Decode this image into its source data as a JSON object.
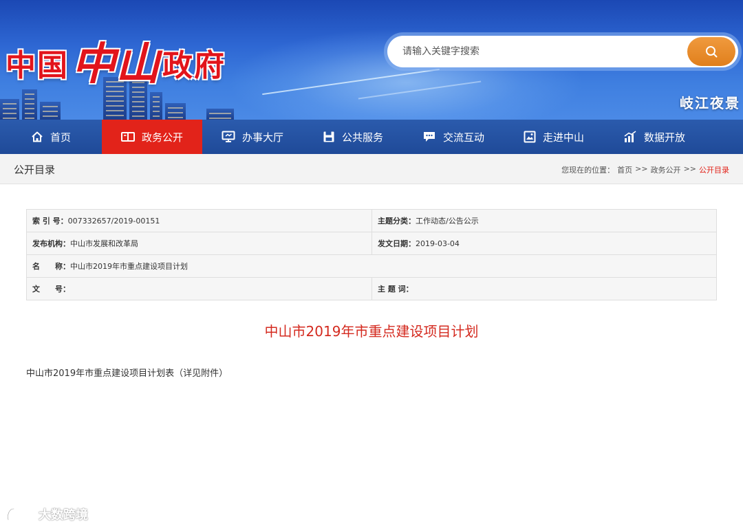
{
  "header": {
    "logo_prefix": "中国",
    "logo_main": "中山",
    "logo_suffix": "政府",
    "search_placeholder": "请输入关键字搜索",
    "motto": "岐江夜景"
  },
  "nav": {
    "items": [
      {
        "label": "首页",
        "icon": "home-icon"
      },
      {
        "label": "政务公开",
        "icon": "book-icon"
      },
      {
        "label": "办事大厅",
        "icon": "monitor-icon"
      },
      {
        "label": "公共服务",
        "icon": "save-icon"
      },
      {
        "label": "交流互动",
        "icon": "chat-icon"
      },
      {
        "label": "走进中山",
        "icon": "picture-icon"
      },
      {
        "label": "数据开放",
        "icon": "chart-icon"
      }
    ],
    "active_index": 1,
    "active_color": "#e2231a"
  },
  "breadcrumb": {
    "section_title": "公开目录",
    "prefix": "您现在的位置：",
    "items": [
      "首页",
      "政务公开",
      "公开目录"
    ],
    "separator": ">>"
  },
  "info": {
    "index_label": "索 引 号：",
    "index_value": "007332657/2019-00151",
    "topic_label": "主题分类：",
    "topic_value": "工作动态/公告公示",
    "org_label": "发布机构：",
    "org_value": "中山市发展和改革局",
    "date_label": "发文日期：",
    "date_value": "2019-03-04",
    "name_label": "名　　称：",
    "name_value": "中山市2019年市重点建设项目计划",
    "docno_label": "文　　号：",
    "docno_value": "",
    "keyword_label": "主 题 词：",
    "keyword_value": ""
  },
  "document": {
    "title": "中山市2019年市重点建设项目计划",
    "body": "中山市2019年市重点建设项目计划表（详见附件）"
  },
  "watermark": {
    "text": "大数跨境"
  },
  "colors": {
    "nav_bg": "#2556a6",
    "accent_red": "#e2231a",
    "search_button": "#e8891f",
    "title_red": "#d42a1f"
  }
}
